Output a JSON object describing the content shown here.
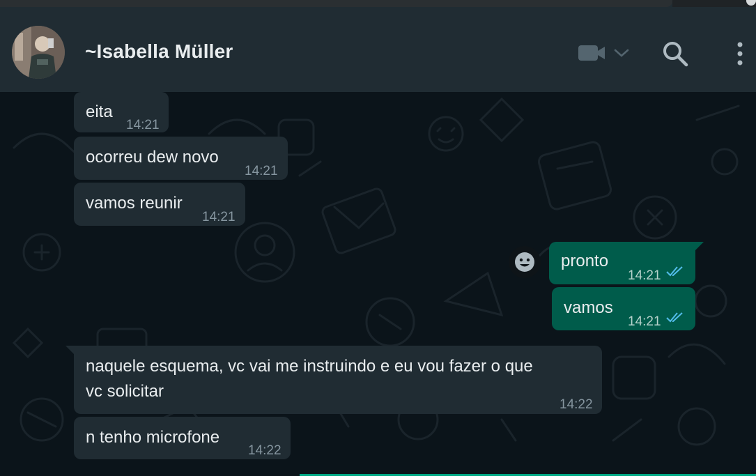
{
  "contact": {
    "name": "~Isabella Müller"
  },
  "header_icons": {
    "video": "video-camera-icon",
    "dropdown": "chevron-down-icon",
    "search": "search-icon",
    "menu": "more-vertical-icon"
  },
  "messages": [
    {
      "direction": "in",
      "text": "eita",
      "time": "14:21"
    },
    {
      "direction": "in",
      "text": "ocorreu dew novo",
      "time": "14:21"
    },
    {
      "direction": "in",
      "text": "vamos reunir",
      "time": "14:21"
    },
    {
      "direction": "out",
      "text": "pronto",
      "time": "14:21",
      "status": "read"
    },
    {
      "direction": "out",
      "text": "vamos",
      "time": "14:21",
      "status": "read"
    },
    {
      "direction": "in",
      "text_line1": "naquele esquema, vc vai me instruindo e eu vou fazer o que",
      "text_line2": "vc solicitar",
      "time": "14:22"
    },
    {
      "direction": "in",
      "text": "n tenho microfone",
      "time": "14:22"
    }
  ],
  "colors": {
    "header_bg": "#202c33",
    "chat_bg": "#0b141a",
    "incoming_bubble": "#202c33",
    "outgoing_bubble": "#005c4b",
    "read_ticks": "#53bdeb",
    "time_text": "#8696a0"
  }
}
